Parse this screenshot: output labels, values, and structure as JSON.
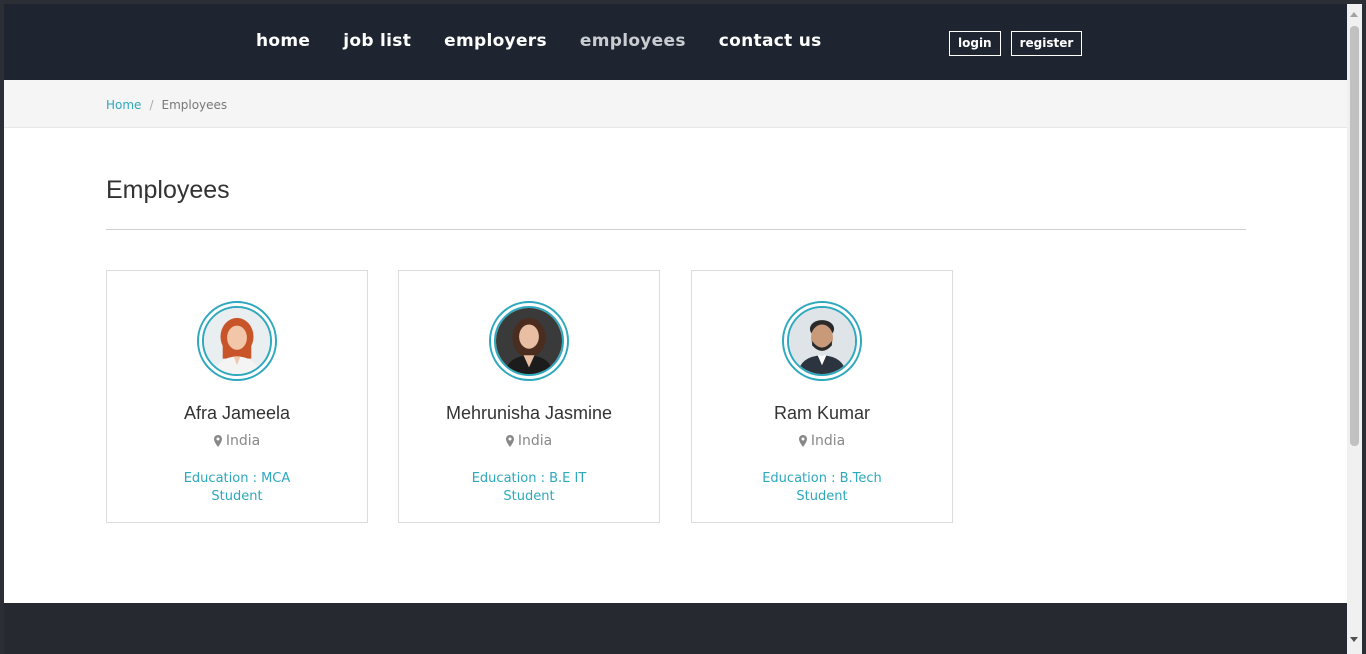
{
  "nav": {
    "items": [
      {
        "label": "home",
        "active": false
      },
      {
        "label": "job list",
        "active": false
      },
      {
        "label": "employers",
        "active": false
      },
      {
        "label": "employees",
        "active": true
      },
      {
        "label": "contact us",
        "active": false
      }
    ],
    "login_label": "login",
    "register_label": "register"
  },
  "breadcrumb": {
    "home": "Home",
    "separator": "/",
    "current": "Employees"
  },
  "page": {
    "title": "Employees"
  },
  "employees": [
    {
      "name": "Afra Jameela",
      "location": "India",
      "education": "Education : MCA",
      "role": "Student"
    },
    {
      "name": "Mehrunisha Jasmine",
      "location": "India",
      "education": "Education : B.E IT",
      "role": "Student"
    },
    {
      "name": "Ram Kumar",
      "location": "India",
      "education": "Education : B.Tech",
      "role": "Student"
    }
  ],
  "colors": {
    "header_bg": "#1f2530",
    "accent": "#2ea8bd",
    "footer_bg": "#262930"
  }
}
